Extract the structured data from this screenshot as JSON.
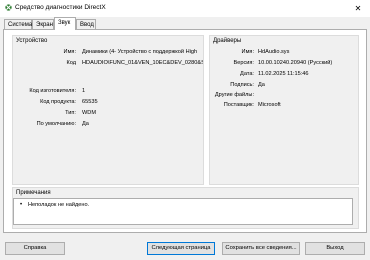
{
  "window": {
    "title": "Средство диагностики DirectX",
    "close_glyph": "✕"
  },
  "tabs": [
    {
      "label": "Система"
    },
    {
      "label": "Экран"
    },
    {
      "label": "Звук"
    },
    {
      "label": "Ввод"
    }
  ],
  "active_tab": "Звук",
  "device": {
    "group_title": "Устройство",
    "name_label": "Имя:",
    "name_value": "Динамики (4- Устройство с поддержкой High",
    "code_label": "Код",
    "code_value": "HDAUDIO\\FUNC_01&VEN_10EC&DEV_0280&SUBSYS_1C",
    "manufacturer_label": "Код изготовителя:",
    "manufacturer_value": "1",
    "product_label": "Код продукта:",
    "product_value": "65535",
    "type_label": "Тип:",
    "type_value": "WDM",
    "default_label": "По умолчанию:",
    "default_value": "Да"
  },
  "drivers": {
    "group_title": "Драйверы",
    "name_label": "Имя:",
    "name_value": "HdAudio.sys",
    "version_label": "Версия:",
    "version_value": "10.00.10240.20940 (Русский)",
    "date_label": "Дата:",
    "date_value": "11.02.2025 11:15:46",
    "signed_label": "Подпись:",
    "signed_value": "Да",
    "other_files_label": "Другие файлы:",
    "other_files_value": "",
    "provider_label": "Поставщик:",
    "provider_value": "Microsoft"
  },
  "notes": {
    "group_title": "Примечания",
    "items": [
      "Неполадок не найдено."
    ]
  },
  "buttons": {
    "help": "Справка",
    "next_page": "Следующая страница",
    "save_all": "Сохранить все сведения...",
    "exit": "Выход"
  },
  "colors": {
    "window_bg": "#f0f0f0",
    "button_face": "#e1e1e1",
    "default_button_border": "#0078d7"
  }
}
